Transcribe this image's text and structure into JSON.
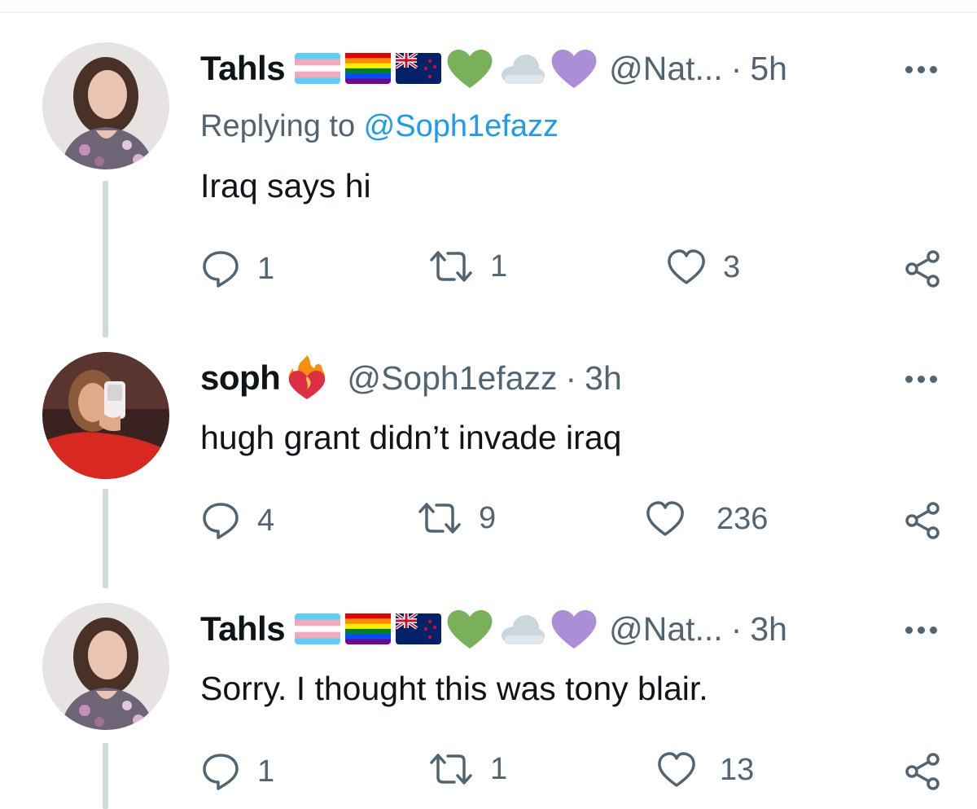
{
  "tweets": [
    {
      "name": "Tahls",
      "handle": "@Nat...",
      "dot": "·",
      "time": "5h",
      "replying_prefix": "Replying to ",
      "replying_to": "@Soph1efazz",
      "text": "Iraq says hi",
      "replies": "1",
      "retweets": "1",
      "likes": "3",
      "emojis": [
        "transgender-flag-emoji",
        "rainbow-flag-emoji",
        "new-zealand-flag-emoji",
        "green-heart-emoji",
        "cloud-emoji",
        "purple-heart-emoji"
      ]
    },
    {
      "name": "soph",
      "handle": "@Soph1efazz",
      "dot": "·",
      "time": "3h",
      "text": "hugh grant didn’t invade iraq",
      "replies": "4",
      "retweets": "9",
      "likes": "236",
      "emojis": [
        "heart-on-fire-emoji"
      ]
    },
    {
      "name": "Tahls",
      "handle": "@Nat...",
      "dot": "·",
      "time": "3h",
      "text": "Sorry. I thought this was tony blair.",
      "replies": "1",
      "retweets": "1",
      "likes": "13",
      "emojis": [
        "transgender-flag-emoji",
        "rainbow-flag-emoji",
        "new-zealand-flag-emoji",
        "green-heart-emoji",
        "cloud-emoji",
        "purple-heart-emoji"
      ]
    }
  ],
  "colors": {
    "text": "#0f1419",
    "secondary": "#536471",
    "link": "#1d9bf0",
    "thread_line": "#cfd9de"
  }
}
